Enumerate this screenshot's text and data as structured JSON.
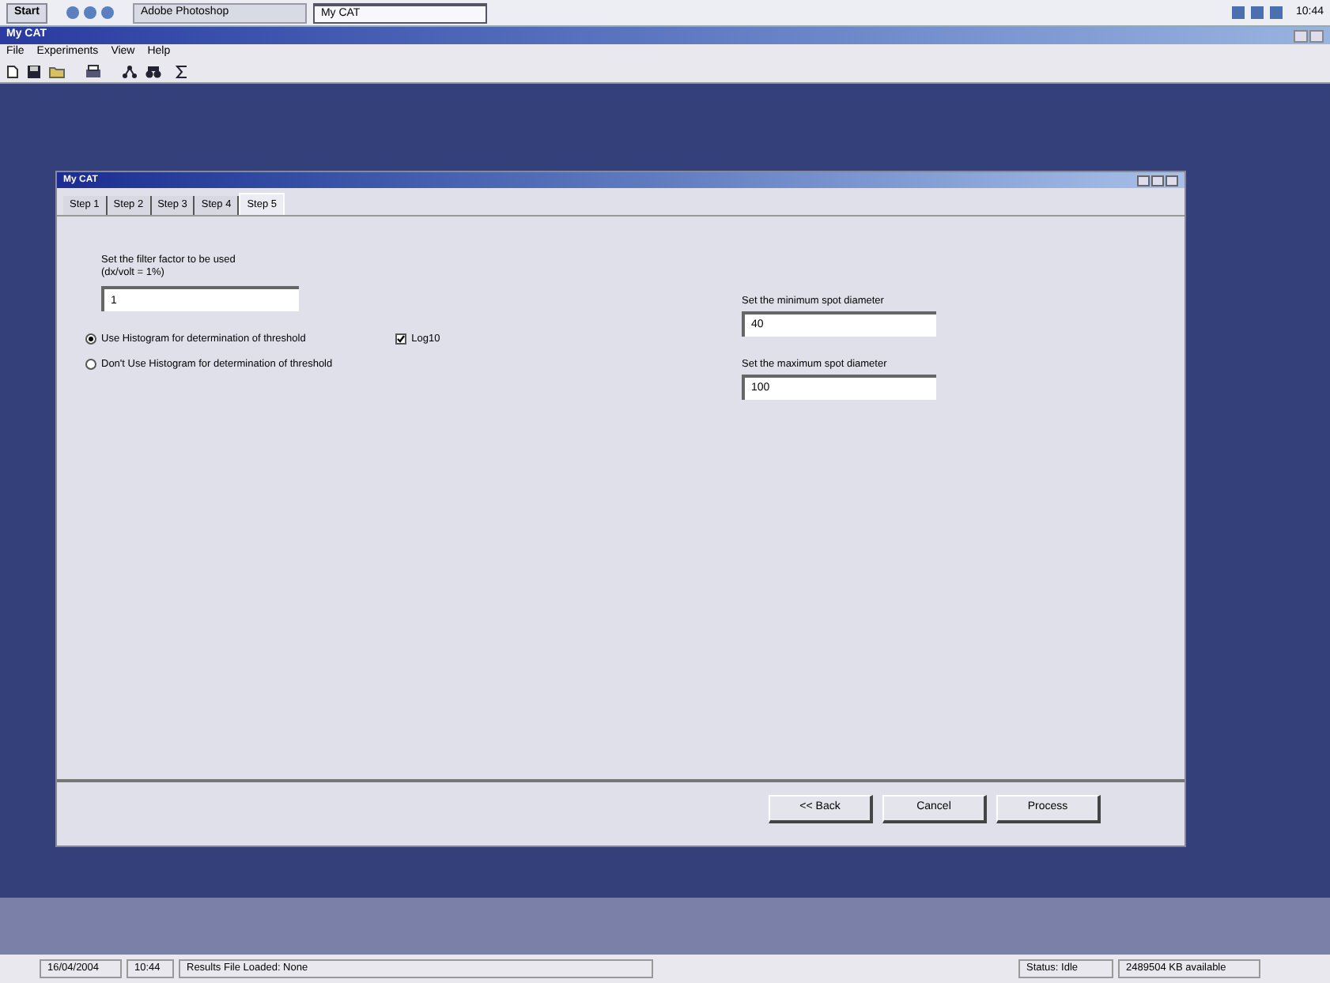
{
  "taskbar": {
    "start": "Start",
    "tasks": [
      {
        "label": "Adobe Photoshop",
        "selected": false
      },
      {
        "label": "My CAT",
        "selected": true
      }
    ],
    "clock": "10:44"
  },
  "window": {
    "title": "My CAT"
  },
  "menu": [
    "File",
    "Experiments",
    "View",
    "Help"
  ],
  "dialog": {
    "title": "My CAT",
    "tabs": [
      {
        "label": "Step 1",
        "selected": false
      },
      {
        "label": "Step 2",
        "selected": false
      },
      {
        "label": "Step 3",
        "selected": false
      },
      {
        "label": "Step 4",
        "selected": false
      },
      {
        "label": "Step 5",
        "selected": true
      }
    ],
    "filter": {
      "label": "Set the filter factor to be used",
      "hint": "(dx/volt = 1%)",
      "value": "1"
    },
    "radios": [
      {
        "label": "Use Histogram for determination of threshold",
        "selected": true
      },
      {
        "label": "Don't Use Histogram for determination of threshold",
        "selected": false
      }
    ],
    "log_checkbox": {
      "label": "Log10",
      "checked": true
    },
    "min_field": {
      "label": "Set the minimum spot diameter",
      "value": "40"
    },
    "max_field": {
      "label": "Set the maximum spot diameter",
      "value": "100"
    },
    "buttons": [
      "<< Back",
      "Cancel",
      "Process"
    ]
  },
  "status_bar": [
    "16/04/2004",
    "10:44",
    "Results File Loaded: None",
    "Status: Idle",
    "2489504 KB available"
  ]
}
